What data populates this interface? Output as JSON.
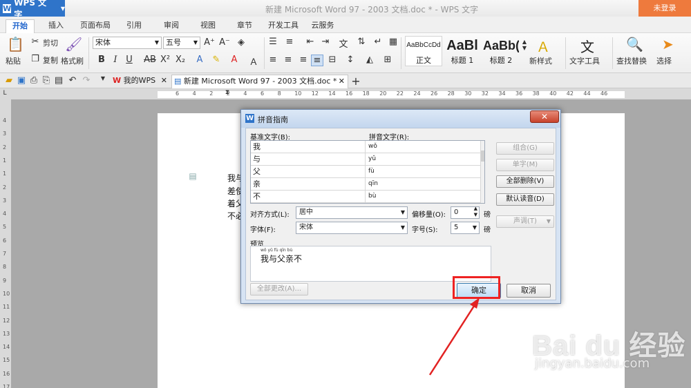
{
  "titlebar": {
    "app_name": "WPS 文字",
    "window_title": "新建 Microsoft Word 97 - 2003 文档.doc * - WPS 文字",
    "login": "未登录"
  },
  "ribbon_tabs": [
    "开始",
    "插入",
    "页面布局",
    "引用",
    "审阅",
    "视图",
    "章节",
    "开发工具",
    "云服务"
  ],
  "ribbon": {
    "paste": "粘贴",
    "cut": "剪切",
    "copy": "复制",
    "format_painter": "格式刷",
    "font_name": "宋体",
    "font_size": "五号",
    "styles": [
      {
        "sample": "AaBbCcDd",
        "name": "正文"
      },
      {
        "sample": "AaBl",
        "name": "标题 1"
      },
      {
        "sample": "AaBb(",
        "name": "标题 2"
      }
    ],
    "new_style": "新样式",
    "text_tools": "文字工具",
    "find_replace": "查找替换",
    "select": "选择"
  },
  "doc_tabs": [
    {
      "label": "我的WPS"
    },
    {
      "label": "新建 Microsoft Word 97 - 2003 文档.doc *"
    }
  ],
  "document": {
    "lines": [
      "我与",
      "差使",
      "着父",
      "不必"
    ]
  },
  "dialog": {
    "title": "拼音指南",
    "col_base": "基准文字(B):",
    "col_pinyin": "拼音文字(R):",
    "rows": [
      {
        "base": "我",
        "pinyin": "wǒ"
      },
      {
        "base": "与",
        "pinyin": "yǔ"
      },
      {
        "base": "父",
        "pinyin": "fù"
      },
      {
        "base": "亲",
        "pinyin": "qīn"
      },
      {
        "base": "不",
        "pinyin": "bù"
      }
    ],
    "btn_group": "组合(G)",
    "btn_single": "单字(M)",
    "btn_clear_all": "全部删除(V)",
    "btn_default_reading": "默认读音(D)",
    "btn_tone": "声调(T)",
    "align_label": "对齐方式(L):",
    "align_value": "居中",
    "offset_label": "偏移量(O):",
    "offset_value": "0",
    "offset_unit": "磅",
    "font_label": "字体(F):",
    "font_value": "宋体",
    "size_label": "字号(S):",
    "size_value": "5",
    "size_unit": "磅",
    "preview_label": "预览",
    "preview_ruby": "wǒ  yǔ  fù  qīn  bù",
    "preview_text": "我与父亲不",
    "btn_change_all": "全部更改(A)...",
    "btn_ok": "确定",
    "btn_cancel": "取消"
  },
  "ruler": {
    "h_ticks": [
      "6",
      "4",
      "2",
      "2",
      "4",
      "6",
      "8",
      "10",
      "12",
      "14",
      "16",
      "18",
      "20",
      "22",
      "24",
      "26",
      "28",
      "30",
      "32",
      "34",
      "36",
      "38",
      "40",
      "42",
      "44",
      "46"
    ],
    "v_ticks": [
      "4",
      "3",
      "2",
      "1",
      "1",
      "2",
      "3",
      "4",
      "5",
      "6",
      "7",
      "8",
      "9",
      "10",
      "11",
      "12",
      "13",
      "14",
      "15",
      "16",
      "17"
    ]
  },
  "watermark": {
    "logo": "Bai du 经验",
    "url": "jingyan.baidu.com"
  },
  "colors": {
    "app_blue": "#2f74c9",
    "login_orange": "#ee7a3d",
    "highlight_red": "#e22222"
  }
}
